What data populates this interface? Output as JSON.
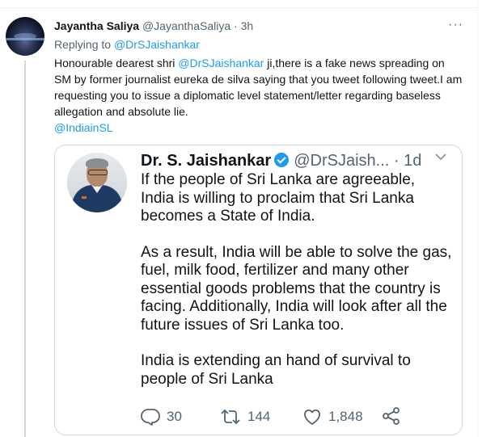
{
  "tweet": {
    "author_name": "Jayantha Saliya",
    "author_handle": "@JayanthaSaliya",
    "separator": "·",
    "time": "3h",
    "more_label": "···",
    "replying_prefix": "Replying to",
    "replying_to": "@DrSJaishankar",
    "text_part1": "Honourable dearest shri ",
    "text_mention": "@DrSJaishankar",
    "text_part2": " ji,there is a fake news spreading on SM by former journalist eureka de silva saying that you tweet following tweet.I am requesting you to issue a diplomatic level statement/letter regarding baseless allegation and absolute lie.",
    "hashtag_mention": "@IndiainSL"
  },
  "embedded": {
    "name": "Dr. S. Jaishankar",
    "handle_time": "@DrSJaish... · 1d",
    "paragraph1": "If the people of Sri Lanka are agreeable, India is willing to proclaim that Sri Lanka becomes a State of India.",
    "paragraph2": "As a result, India will be able to solve the gas, fuel, milk food, fertilizer and many other essential goods problems that the country is facing. Additionally, India will look after all the future issues of Sri Lanka too.",
    "paragraph3": "India is extending an hand of survival to people of Sri Lanka",
    "reply_count": "30",
    "retweet_count": "144",
    "like_count": "1,848"
  },
  "icons": [
    "more-icon",
    "verified-icon",
    "chevron-down-icon",
    "reply-icon",
    "retweet-icon",
    "like-icon",
    "share-icon"
  ],
  "colors": {
    "link": "#1d9bf0",
    "muted": "#536471",
    "text": "#0f1419",
    "border": "#cfd9de"
  }
}
